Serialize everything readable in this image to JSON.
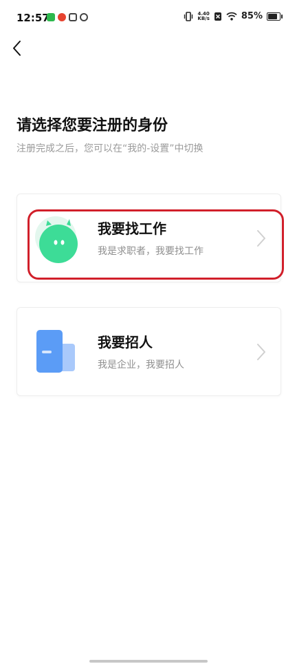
{
  "status": {
    "time": "12:57",
    "speed_value": "4.40",
    "speed_unit": "KB/s",
    "battery": "85%"
  },
  "header": {
    "back_icon": "chevron-left-icon"
  },
  "page": {
    "title": "请选择您要注册的身份",
    "subtitle": "注册完成之后，您可以在“我的-设置”中切换"
  },
  "options": [
    {
      "title": "我要找工作",
      "desc": "我是求职者，我要找工作",
      "icon": "job-seeker-avatar-icon",
      "color": "#3ddc97"
    },
    {
      "title": "我要招人",
      "desc": "我是企业，我要招人",
      "icon": "company-building-icon",
      "color": "#5b9cf6"
    }
  ]
}
